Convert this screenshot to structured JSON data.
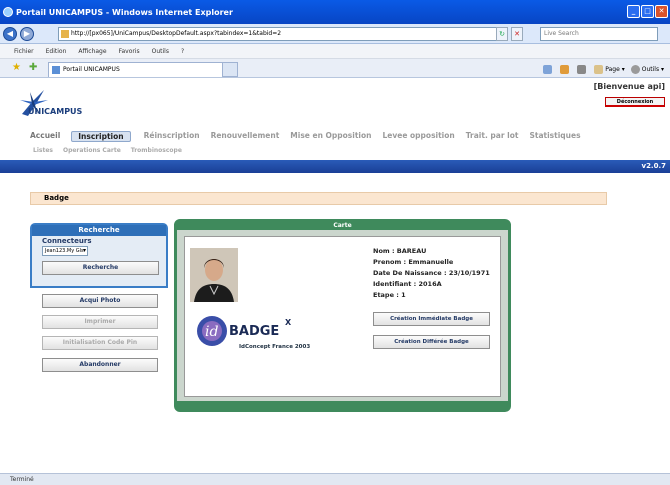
{
  "window": {
    "title": "Portail UNICAMPUS - Windows Internet Explorer",
    "buttons": [
      "_",
      "□",
      "✕"
    ]
  },
  "address": {
    "url": "http://[px065]/UniCampus/DesktopDefault.aspx?tabindex=1&tabid=2",
    "search_placeholder": "Live Search"
  },
  "menu": [
    "Fichier",
    "Edition",
    "Affichage",
    "Favoris",
    "Outils",
    "?"
  ],
  "tab": {
    "title": "Portail UNICAMPUS"
  },
  "tools": [
    "Page ▾",
    "Outils ▾"
  ],
  "header": {
    "logo_text": "UNICAMPUS",
    "welcome": "[Bienvenue api]",
    "disconnect": "Déconnexion"
  },
  "nav": {
    "primary": [
      "Accueil",
      "Inscription",
      "Réinscription",
      "Renouvellement",
      "Mise en Opposition",
      "Levee opposition",
      "Trait. par lot",
      "Statistiques"
    ],
    "active": "Inscription",
    "secondary": [
      "Listes",
      "Operations Carte",
      "Trombinoscope"
    ]
  },
  "version": "v2.0.7",
  "section_title": "Badge",
  "search": {
    "title": "Recherche",
    "connectors_label": "Connecteurs",
    "connector_value": "Jean123.My Gls",
    "search_button": "Recherche"
  },
  "actions": [
    {
      "label": "Acqui Photo",
      "enabled": true
    },
    {
      "label": "Imprimer",
      "enabled": false
    },
    {
      "label": "Initialisation Code Pin",
      "enabled": false
    },
    {
      "label": "Abandonner",
      "enabled": true
    }
  ],
  "carte": {
    "title": "Carte",
    "nom": "Nom : BAREAU",
    "prenom": "Prenom : Emmanuelle",
    "naissance": "Date De Naissance : 23/10/1971",
    "identifiant": "Identifiant : 2016A",
    "etape": "Etape : 1",
    "badge_logo": "BADGE",
    "badge_sup": "X",
    "caption": "IdConcept France 2003",
    "btn_immediate": "Création Immédiate Badge",
    "btn_differee": "Création Différée Badge"
  },
  "status": "Terminé",
  "colors": {
    "primary_blue": "#1a3f96",
    "green": "#3f8a5c",
    "badge_bar": "#fbe6d0"
  }
}
